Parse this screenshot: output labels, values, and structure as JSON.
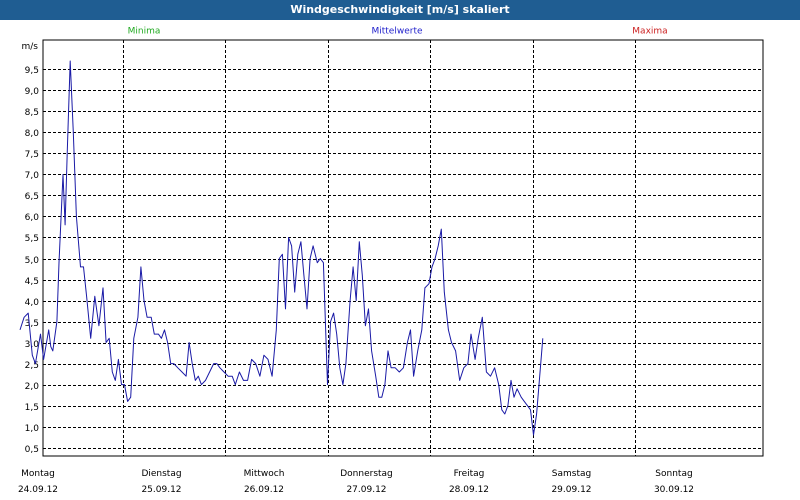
{
  "window": {
    "title": "Windgeschwindigkeit [m/s] skaliert"
  },
  "legend": [
    {
      "label": "Minima",
      "color": "#22aa22"
    },
    {
      "label": "Mittelwerte",
      "color": "#2222cc"
    },
    {
      "label": "Maxima",
      "color": "#cc2222"
    }
  ],
  "chart_data": {
    "type": "line",
    "ylabel": "m/s",
    "ylim": [
      0.3,
      10.2
    ],
    "yticks": [
      0.5,
      1.0,
      1.5,
      2.0,
      2.5,
      3.0,
      3.5,
      4.0,
      4.5,
      5.0,
      5.5,
      6.0,
      6.5,
      7.0,
      7.5,
      8.0,
      8.5,
      9.0,
      9.5
    ],
    "ytick_labels": [
      "0,5",
      "1,0",
      "1,5",
      "2,0",
      "2,5",
      "3,0",
      "3,5",
      "4,0",
      "4,5",
      "5,0",
      "5,5",
      "6,0",
      "6,5",
      "7,0",
      "7,5",
      "8,0",
      "8,5",
      "9,0",
      "9,5"
    ],
    "xlim": [
      0,
      7
    ],
    "days": [
      {
        "weekday": "Montag",
        "date": "24.09.12"
      },
      {
        "weekday": "Dienstag",
        "date": "25.09.12"
      },
      {
        "weekday": "Mittwoch",
        "date": "26.09.12"
      },
      {
        "weekday": "Donnerstag",
        "date": "27.09.12"
      },
      {
        "weekday": "Freitag",
        "date": "28.09.12"
      },
      {
        "weekday": "Samstag",
        "date": "29.09.12"
      },
      {
        "weekday": "Sonntag",
        "date": "30.09.12"
      }
    ],
    "grid": true,
    "series": [
      {
        "name": "Mittelwerte",
        "color": "#1a1aa6",
        "points": [
          [
            0.0,
            3.3
          ],
          [
            0.04,
            3.6
          ],
          [
            0.08,
            3.7
          ],
          [
            0.12,
            2.7
          ],
          [
            0.15,
            2.5
          ],
          [
            0.2,
            3.2
          ],
          [
            0.23,
            2.6
          ],
          [
            0.28,
            3.3
          ],
          [
            0.3,
            2.9
          ],
          [
            0.32,
            2.8
          ],
          [
            0.36,
            3.5
          ],
          [
            0.38,
            4.9
          ],
          [
            0.42,
            7.0
          ],
          [
            0.44,
            5.8
          ],
          [
            0.46,
            7.5
          ],
          [
            0.49,
            9.7
          ],
          [
            0.52,
            8.0
          ],
          [
            0.55,
            6.0
          ],
          [
            0.59,
            4.8
          ],
          [
            0.62,
            4.8
          ],
          [
            0.65,
            4.1
          ],
          [
            0.69,
            3.1
          ],
          [
            0.73,
            4.1
          ],
          [
            0.77,
            3.4
          ],
          [
            0.81,
            4.3
          ],
          [
            0.84,
            3.0
          ],
          [
            0.87,
            3.1
          ],
          [
            0.9,
            2.3
          ],
          [
            0.93,
            2.1
          ],
          [
            0.96,
            2.6
          ],
          [
            0.99,
            2.0
          ],
          [
            1.02,
            2.0
          ],
          [
            1.05,
            1.6
          ],
          [
            1.08,
            1.7
          ],
          [
            1.11,
            3.1
          ],
          [
            1.15,
            3.6
          ],
          [
            1.18,
            4.8
          ],
          [
            1.21,
            4.0
          ],
          [
            1.24,
            3.6
          ],
          [
            1.28,
            3.6
          ],
          [
            1.31,
            3.2
          ],
          [
            1.35,
            3.2
          ],
          [
            1.38,
            3.1
          ],
          [
            1.41,
            3.3
          ],
          [
            1.44,
            3.0
          ],
          [
            1.47,
            2.5
          ],
          [
            1.5,
            2.5
          ],
          [
            1.54,
            2.4
          ],
          [
            1.58,
            2.3
          ],
          [
            1.62,
            2.2
          ],
          [
            1.65,
            3.0
          ],
          [
            1.68,
            2.5
          ],
          [
            1.71,
            2.1
          ],
          [
            1.74,
            2.2
          ],
          [
            1.77,
            2.0
          ],
          [
            1.81,
            2.1
          ],
          [
            1.85,
            2.3
          ],
          [
            1.89,
            2.5
          ],
          [
            1.92,
            2.5
          ],
          [
            1.95,
            2.4
          ],
          [
            1.99,
            2.3
          ],
          [
            2.03,
            2.2
          ],
          [
            2.07,
            2.2
          ],
          [
            2.1,
            2.0
          ],
          [
            2.14,
            2.3
          ],
          [
            2.18,
            2.1
          ],
          [
            2.22,
            2.1
          ],
          [
            2.26,
            2.6
          ],
          [
            2.3,
            2.5
          ],
          [
            2.34,
            2.2
          ],
          [
            2.38,
            2.7
          ],
          [
            2.42,
            2.6
          ],
          [
            2.46,
            2.2
          ],
          [
            2.5,
            3.3
          ],
          [
            2.53,
            5.0
          ],
          [
            2.56,
            5.1
          ],
          [
            2.59,
            3.8
          ],
          [
            2.62,
            5.5
          ],
          [
            2.65,
            5.3
          ],
          [
            2.68,
            4.2
          ],
          [
            2.71,
            5.1
          ],
          [
            2.74,
            5.4
          ],
          [
            2.77,
            4.6
          ],
          [
            2.8,
            3.8
          ],
          [
            2.83,
            5.0
          ],
          [
            2.86,
            5.3
          ],
          [
            2.9,
            4.9
          ],
          [
            2.93,
            5.0
          ],
          [
            2.96,
            4.9
          ],
          [
            3.0,
            2.0
          ],
          [
            3.03,
            3.5
          ],
          [
            3.06,
            3.7
          ],
          [
            3.09,
            3.2
          ],
          [
            3.12,
            2.4
          ],
          [
            3.15,
            2.0
          ],
          [
            3.18,
            2.5
          ],
          [
            3.22,
            4.0
          ],
          [
            3.25,
            4.8
          ],
          [
            3.28,
            4.0
          ],
          [
            3.31,
            5.4
          ],
          [
            3.34,
            4.6
          ],
          [
            3.37,
            3.4
          ],
          [
            3.4,
            3.8
          ],
          [
            3.43,
            2.8
          ],
          [
            3.47,
            2.2
          ],
          [
            3.5,
            1.7
          ],
          [
            3.53,
            1.7
          ],
          [
            3.56,
            2.0
          ],
          [
            3.59,
            2.8
          ],
          [
            3.62,
            2.4
          ],
          [
            3.66,
            2.4
          ],
          [
            3.7,
            2.3
          ],
          [
            3.74,
            2.4
          ],
          [
            3.78,
            3.0
          ],
          [
            3.81,
            3.3
          ],
          [
            3.84,
            2.2
          ],
          [
            3.88,
            2.8
          ],
          [
            3.92,
            3.3
          ],
          [
            3.95,
            4.3
          ],
          [
            3.99,
            4.4
          ],
          [
            4.02,
            4.8
          ],
          [
            4.05,
            5.0
          ],
          [
            4.08,
            5.3
          ],
          [
            4.11,
            5.7
          ],
          [
            4.14,
            4.2
          ],
          [
            4.18,
            3.3
          ],
          [
            4.21,
            3.0
          ],
          [
            4.25,
            2.8
          ],
          [
            4.29,
            2.1
          ],
          [
            4.33,
            2.4
          ],
          [
            4.37,
            2.5
          ],
          [
            4.4,
            3.2
          ],
          [
            4.44,
            2.6
          ],
          [
            4.47,
            3.1
          ],
          [
            4.51,
            3.6
          ],
          [
            4.55,
            2.3
          ],
          [
            4.59,
            2.2
          ],
          [
            4.63,
            2.4
          ],
          [
            4.67,
            2.0
          ],
          [
            4.7,
            1.4
          ],
          [
            4.73,
            1.3
          ],
          [
            4.76,
            1.5
          ],
          [
            4.79,
            2.1
          ],
          [
            4.82,
            1.7
          ],
          [
            4.85,
            1.9
          ],
          [
            4.89,
            1.7
          ],
          [
            4.92,
            1.6
          ],
          [
            4.95,
            1.5
          ],
          [
            4.98,
            1.4
          ],
          [
            5.01,
            0.8
          ],
          [
            5.04,
            1.3
          ],
          [
            5.07,
            2.2
          ],
          [
            5.1,
            3.1
          ]
        ]
      }
    ]
  }
}
